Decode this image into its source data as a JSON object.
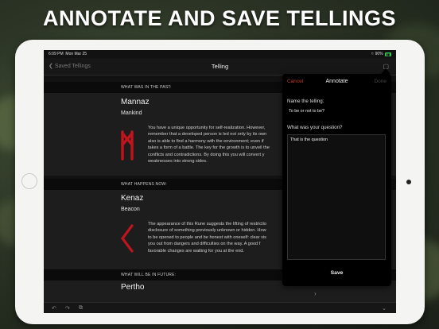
{
  "headline": "ANNOTATE AND SAVE TELLINGS",
  "status": {
    "time": "6:09 PM",
    "date": "Mon Mar 25",
    "battery": "90%"
  },
  "nav": {
    "back_label": "Saved Tellings",
    "title": "Telling"
  },
  "sections": [
    {
      "header": "WHAT WAS IN THE PAST:",
      "rune": "Mannaz",
      "meaning": "Mankind",
      "description": [
        "You have a unique opportunity for self-realization. However,",
        "remember that a developed person is led not only by its own",
        "also is able to find a harmony with the environment; even if",
        "takes a form of a battle. The key for the growth is to unveil the",
        "conflicts and contradictions. By doing this you will convert y",
        "weaknesses into strong sides."
      ]
    },
    {
      "header": "WHAT HAPPENS NOW:",
      "rune": "Kenaz",
      "meaning": "Beacon",
      "description": [
        "The appearance of this Rune suggests the lifting of restrictio",
        "disclosure of something previously unknown or hidden. How",
        "to be opened to people and be honest with oneself: clear vis",
        "you out  from dangers and difficulties on the way. A good f",
        "favorable changes are waiting for you at the end."
      ]
    },
    {
      "header": "WHAT WILL BE IN FUTURE:",
      "rune": "Pertho"
    }
  ],
  "popover": {
    "cancel_label": "Cancel",
    "title": "Annotate",
    "done_label": "Done",
    "name_label": "Name the telling:",
    "name_value": "To be or not to be?",
    "question_label": "What was your question?",
    "question_value": "That is the question",
    "save_label": "Save"
  },
  "colors": {
    "rune_red": "#c0151c",
    "cancel_red": "#c0392b"
  }
}
